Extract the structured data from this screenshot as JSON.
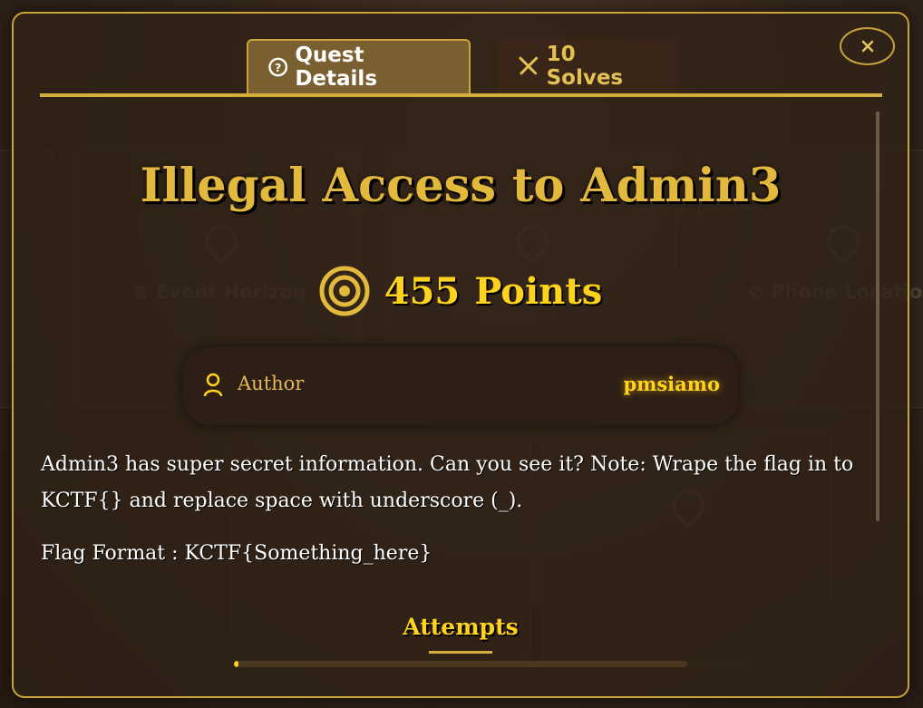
{
  "tabs": {
    "details_label": "Quest Details",
    "solves_label": "10 Solves",
    "details_icon": "question-circle-icon",
    "solves_icon": "crossed-swords-icon"
  },
  "close_icon": "close-icon",
  "challenge": {
    "title": "Illegal Access to Admin3",
    "points_value": "455",
    "points_label": "Points",
    "author_label": "Author",
    "author_name": "pmsiamo",
    "description": "Admin3 has super secret information. Can you see it? Note: Wrape the flag in to KCTF{} and replace space with underscore (_).",
    "flag_format": "Flag Format : KCTF{Something_here}"
  },
  "attempts": {
    "title": "Attempts",
    "progress_fraction": 0.01
  },
  "colors": {
    "accent_gold": "#d4ae3a",
    "title_gold": "#e2b93d",
    "bright_yellow": "#ffd21e"
  }
}
